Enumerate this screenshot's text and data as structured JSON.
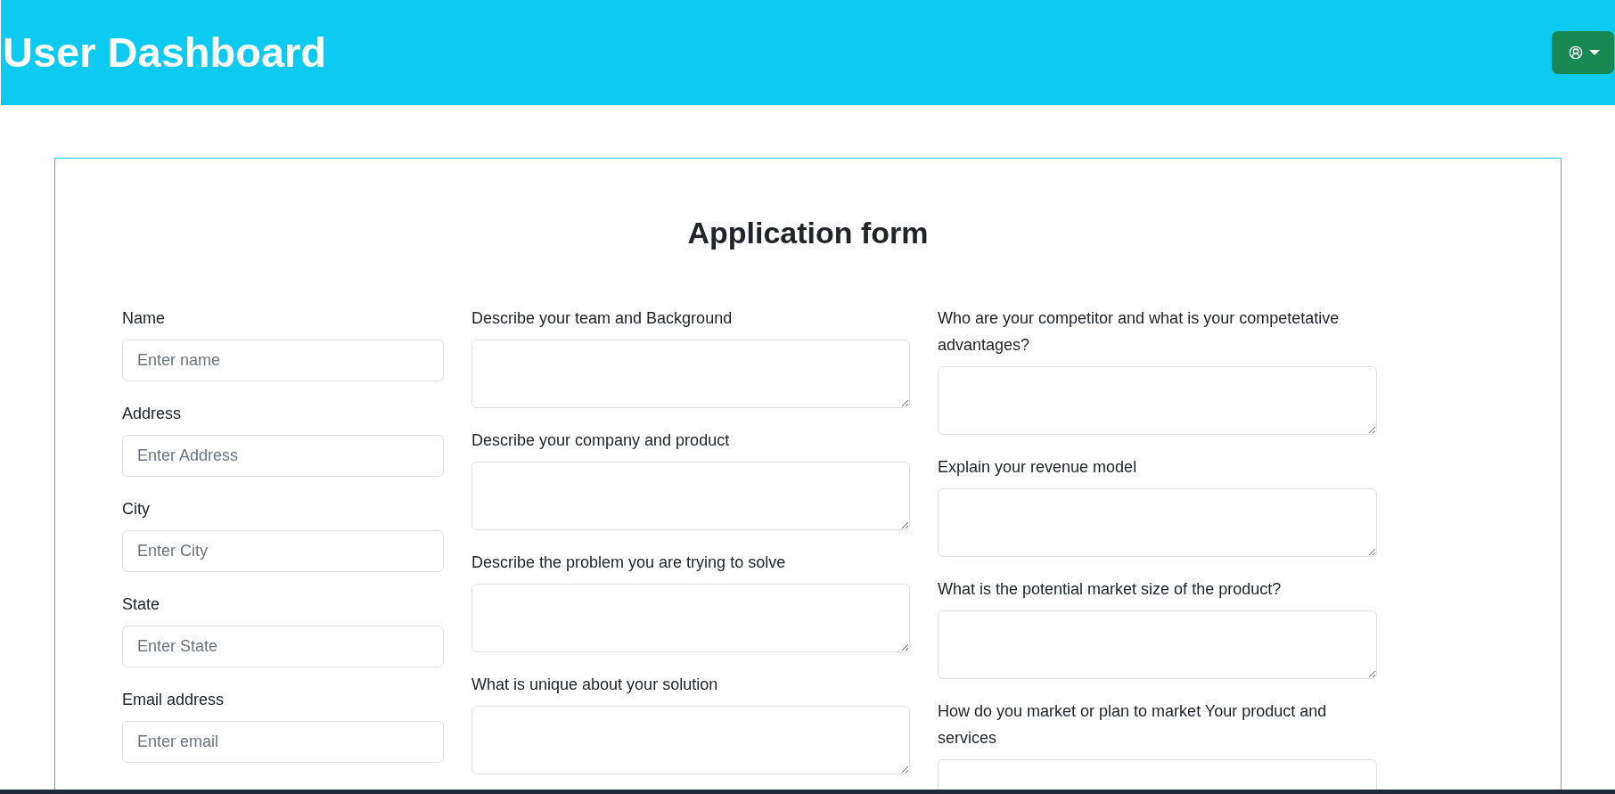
{
  "header": {
    "title": "User Dashboard"
  },
  "form": {
    "title": "Application form",
    "columns": [
      {
        "fields": [
          {
            "kind": "input",
            "label": "Name",
            "placeholder": "Enter name"
          },
          {
            "kind": "input",
            "label": "Address",
            "placeholder": "Enter Address"
          },
          {
            "kind": "input",
            "label": "City",
            "placeholder": "Enter City"
          },
          {
            "kind": "input",
            "label": "State",
            "placeholder": "Enter State"
          },
          {
            "kind": "input",
            "label": "Email address",
            "placeholder": "Enter email"
          }
        ]
      },
      {
        "fields": [
          {
            "kind": "textarea",
            "label": "Describe your team and Background"
          },
          {
            "kind": "textarea",
            "label": "Describe your company and product"
          },
          {
            "kind": "textarea",
            "label": "Describe the problem you are trying to solve"
          },
          {
            "kind": "textarea",
            "label": "What is unique about your solution"
          }
        ]
      },
      {
        "fields": [
          {
            "kind": "textarea",
            "label": "Who are your competitor and what is your competetative advantages?"
          },
          {
            "kind": "textarea",
            "label": "Explain your revenue model"
          },
          {
            "kind": "textarea",
            "label": "What is the potential market size of the product?"
          },
          {
            "kind": "textarea",
            "label": "How do you market or plan to market Your product and services"
          }
        ]
      }
    ]
  }
}
